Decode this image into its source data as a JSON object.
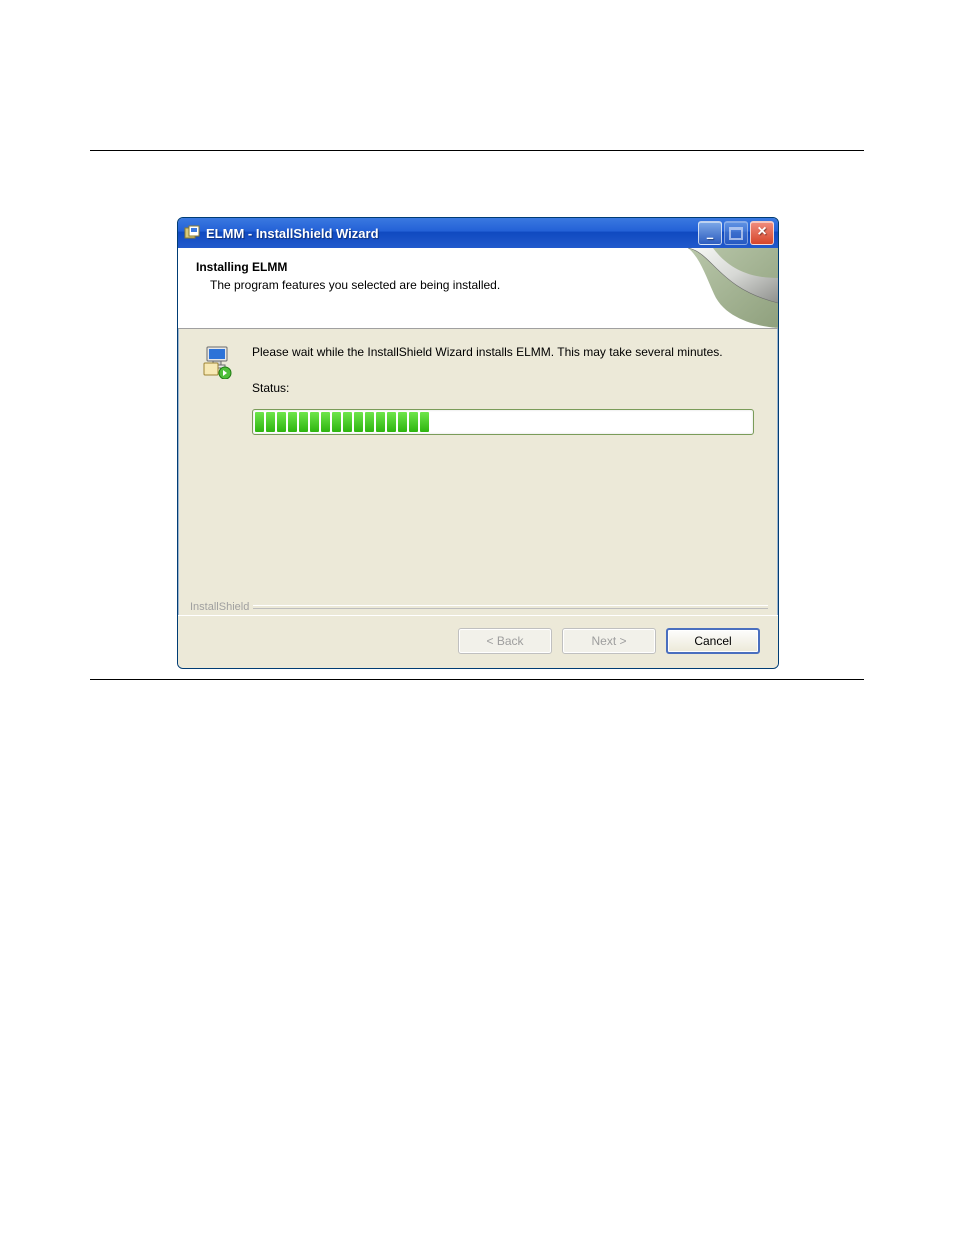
{
  "window": {
    "title": "ELMM - InstallShield Wizard"
  },
  "header": {
    "title": "Installing ELMM",
    "subtitle": "The program features you selected are being installed."
  },
  "body": {
    "message": "Please wait while the InstallShield Wizard installs ELMM. This may take several minutes.",
    "status_label": "Status:",
    "progress_percent": 33,
    "progress_chunks": 16
  },
  "legend": {
    "brand": "InstallShield"
  },
  "footer": {
    "back": "< Back",
    "next": "Next >",
    "cancel": "Cancel"
  }
}
